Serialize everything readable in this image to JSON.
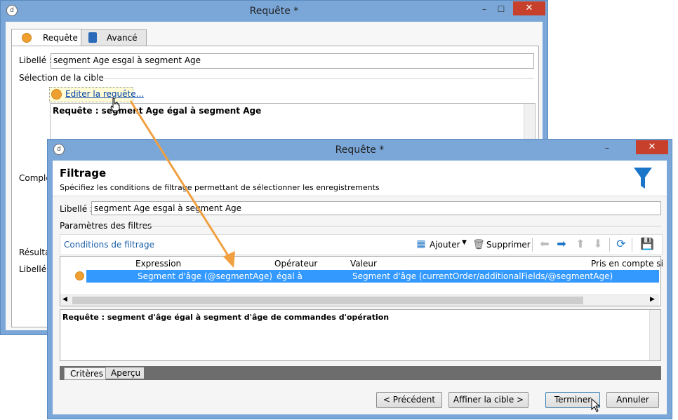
{
  "back_window": {
    "title": "Requête *",
    "controls": {
      "minimize": "–",
      "maximize": "☐",
      "close": "✕"
    },
    "tabs": [
      {
        "label": "Requête"
      },
      {
        "label": "Avancé"
      }
    ],
    "libelle_label": "Libellé :",
    "libelle_value": "segment Age esgal à segment Age",
    "section_cible": "Sélection de la cible",
    "edit_link": "Editer la requête...",
    "query_text": "Requête : segment Age égal à segment Age",
    "complement_label": "Complé",
    "resultat_label": "Résultat",
    "libelle2_label": "Libellé :"
  },
  "front_window": {
    "title": "Requête *",
    "controls": {
      "minimize": "–",
      "close": "✕"
    },
    "heading": "Filtrage",
    "subheading": "Spécifiez les conditions de filtrage permettant de sélectionner les enregistrements",
    "libelle_label": "Libellé :",
    "libelle_value": "segment  Age esgal à segment Age",
    "section_params": "Paramètres des filtres",
    "toolbar": {
      "conditions_label": "Conditions de filtrage",
      "add_label": "Ajouter",
      "delete_label": "Supprimer"
    },
    "grid": {
      "columns": [
        "Expression",
        "Opérateur",
        "Valeur",
        "Pris en compte si"
      ],
      "rows": [
        {
          "expression": "Segment d'âge (@segmentAge)",
          "operator": "égal à",
          "value": "Segment d'âge (currentOrder/additionalFields/@segmentAge)",
          "condition": ""
        }
      ]
    },
    "query_text": "Requête : segment d'âge égal à segment d'âge de commandes d'opération",
    "bottom_tabs": [
      {
        "label": "Critères"
      },
      {
        "label": "Aperçu"
      }
    ],
    "buttons": {
      "previous": "< Précédent",
      "refine": "Affiner la cible >",
      "finish": "Terminer",
      "cancel": "Annuler"
    }
  },
  "colors": {
    "accent_blue": "#1a74c8",
    "selection": "#3399ff",
    "orange": "#f0a030",
    "close_red": "#c7402b",
    "title_blue": "#7aa7d8"
  }
}
